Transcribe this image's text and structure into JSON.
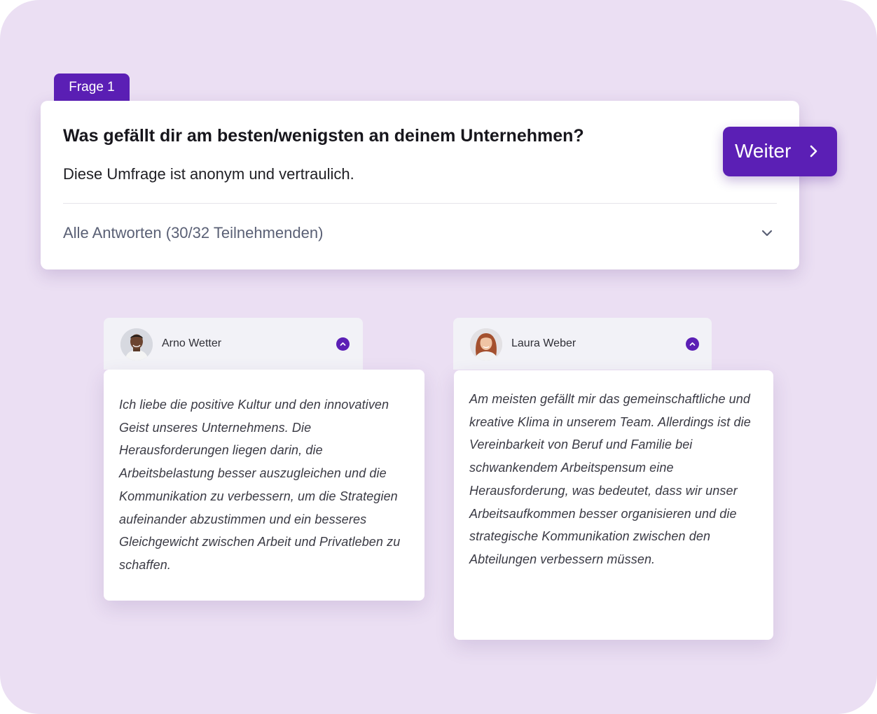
{
  "question": {
    "badge": "Frage 1",
    "title": "Was gefällt dir am besten/wenigsten an deinem Unternehmen?",
    "subtitle": "Diese Umfrage ist anonym und vertraulich.",
    "answers_summary": "Alle Antworten (30/32 Teilnehmenden)"
  },
  "next_button": {
    "label": "Weiter"
  },
  "responses": [
    {
      "name": "Arno Wetter",
      "text": "Ich liebe die positive Kultur und den innovativen Geist unseres Unternehmens. Die Herausforderungen liegen darin, die Arbeitsbelastung besser auszugleichen und die Kommunikation zu verbessern, um die Strategien aufeinander abzustimmen und ein besseres Gleichgewicht zwischen Arbeit und Privatleben zu schaffen."
    },
    {
      "name": "Laura Weber",
      "text": "Am meisten gefällt mir das gemeinschaftliche und kreative Klima in unserem Team. Allerdings ist die Vereinbarkeit von Beruf und Familie bei schwankendem Arbeitspensum eine Herausforderung, was bedeutet, dass wir unser Arbeitsaufkommen besser organisieren und die strategische Kommunikation zwischen den Abteilungen verbessern müssen."
    }
  ],
  "colors": {
    "background": "#ebdff3",
    "accent": "#5b1fb5",
    "card": "#ffffff",
    "header": "#f2f2f7"
  },
  "icons": {
    "expand": "chevron-down-icon",
    "next": "chevron-right-icon",
    "collapse": "chevron-up-icon"
  }
}
